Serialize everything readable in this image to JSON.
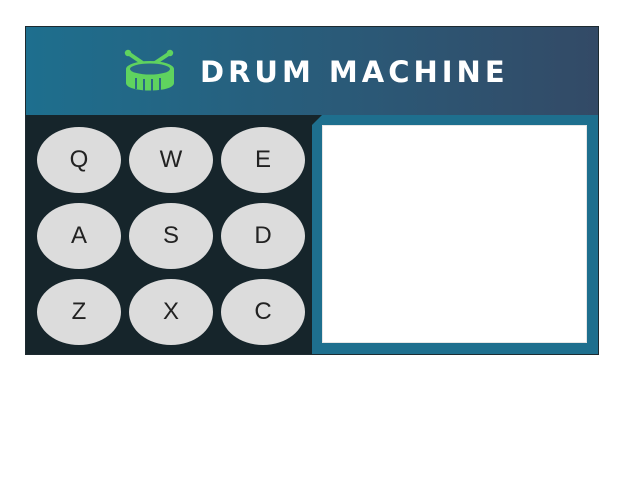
{
  "app": {
    "title": "DRUM MACHINE",
    "logo_icon": "drum-icon",
    "colors": {
      "header_start": "#1e6f8e",
      "header_end": "#334a66",
      "panel": "#16252b",
      "pad": "#dcdcdc",
      "logo": "#5fd35f",
      "display_frame": "#1e6f8e"
    }
  },
  "pads": [
    {
      "key": "Q"
    },
    {
      "key": "W"
    },
    {
      "key": "E"
    },
    {
      "key": "A"
    },
    {
      "key": "S"
    },
    {
      "key": "D"
    },
    {
      "key": "Z"
    },
    {
      "key": "X"
    },
    {
      "key": "C"
    }
  ],
  "display": {
    "text": ""
  }
}
